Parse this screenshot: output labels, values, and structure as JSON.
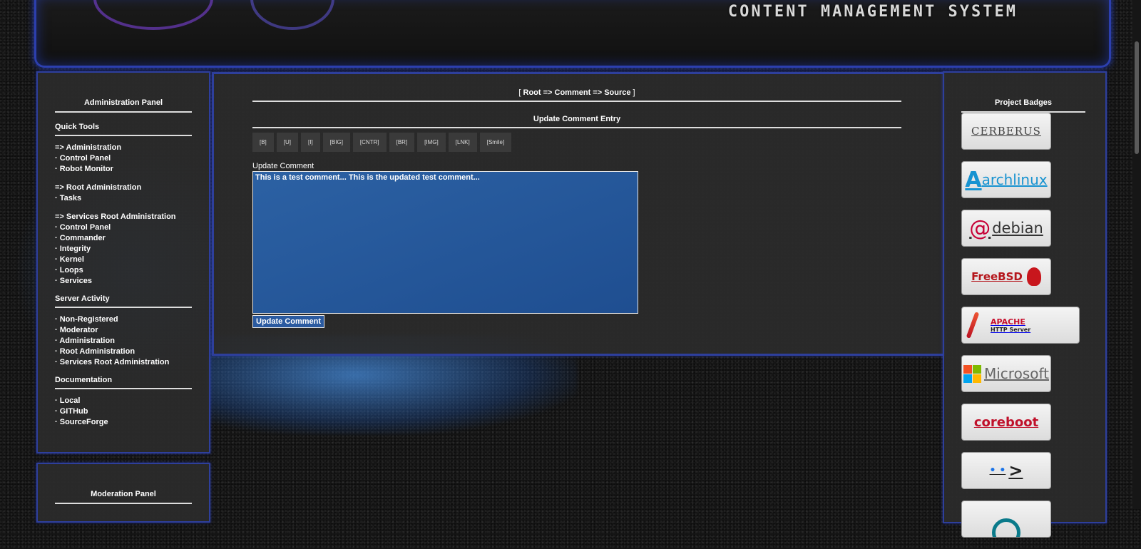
{
  "header": {
    "title": "CONTENT MANAGEMENT SYSTEM"
  },
  "left_panel": {
    "title": "Administration Panel",
    "quick_tools": {
      "heading": "Quick Tools",
      "groups": [
        {
          "head": "=> Administration",
          "items": [
            "Control Panel",
            "Robot Monitor"
          ]
        },
        {
          "head": "=> Root Administration",
          "items": [
            "Tasks"
          ]
        },
        {
          "head": "=> Services Root Administration",
          "items": [
            "Control Panel",
            "Commander",
            "Integrity",
            "Kernel",
            "Loops",
            "Services"
          ]
        }
      ]
    },
    "server_activity": {
      "heading": "Server Activity",
      "items": [
        "Non-Registered",
        "Moderator",
        "Administration",
        "Root Administration",
        "Services Root Administration"
      ]
    },
    "documentation": {
      "heading": "Documentation",
      "items": [
        "Local",
        "GITHub",
        "SourceForge"
      ]
    }
  },
  "moderation_panel": {
    "title": "Moderation Panel"
  },
  "main": {
    "breadcrumb": {
      "open": "[",
      "path": "Root => Comment => Source",
      "close": "]"
    },
    "section_title": "Update Comment Entry",
    "toolbar": [
      "[B]",
      "[U]",
      "[I]",
      "[BIG]",
      "[CNTR]",
      "[BR]",
      "[IMG]",
      "[LNK]",
      "[Smile]"
    ],
    "field_label": "Update Comment",
    "comment_value": "This is a test comment... This is the updated test comment...",
    "submit_label": "Update Comment"
  },
  "right_panel": {
    "title": "Project Badges",
    "badges": {
      "cerberus": "CERBERUS",
      "arch_a": "A",
      "arch_text": "archlinux",
      "debian": "debian",
      "freebsd": "FreeBSD",
      "apache_1": "APACHE",
      "apache_2": "HTTP Server",
      "microsoft": "Microsoft",
      "coreboot": "coreboot"
    },
    "colors": {
      "ms_red": "#f25022",
      "ms_green": "#7fba00",
      "ms_blue": "#00a4ef",
      "ms_yellow": "#ffb900"
    }
  },
  "colors": {
    "panel_border": "#2e3f9c",
    "textarea_bg": "#2c64aa",
    "panel_bg": "#2b2b2b"
  }
}
